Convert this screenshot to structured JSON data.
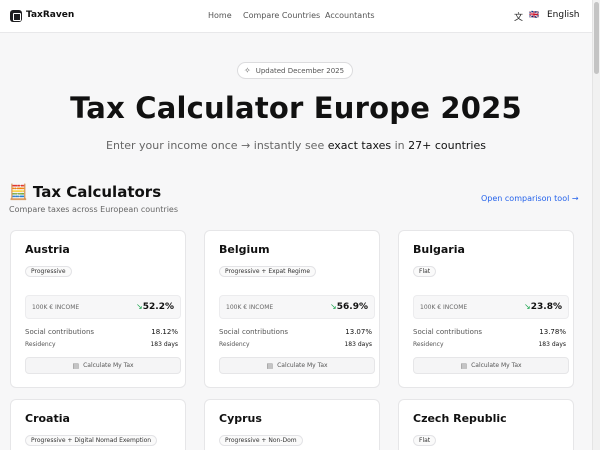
{
  "header": {
    "brand": "TaxRaven",
    "nav": [
      {
        "label": "Home"
      },
      {
        "label": "Compare Countries"
      },
      {
        "label": "Accountants"
      }
    ],
    "lang_icon": "translate-icon",
    "lang_flag": "🇬🇧",
    "lang_label": "English"
  },
  "hero": {
    "badge": "Updated December 2025",
    "badge_icon": "sparkle-icon",
    "title": "Tax Calculator Europe 2025",
    "sub_1": "Enter your income once → instantly see ",
    "sub_2": "exact taxes",
    "sub_3": " in ",
    "sub_4": "27+ countries"
  },
  "section": {
    "title": "🧮 Tax Calculators",
    "subtitle": "Compare taxes across European countries",
    "link": "Open comparison tool →"
  },
  "cards": [
    {
      "name": "Austria",
      "tag": "Progressive",
      "income_label": "100K € INCOME",
      "rate": "52.2%",
      "social_label": "Social contributions",
      "social": "18.12%",
      "residency_label": "Residency",
      "residency": "183 days",
      "button": "Calculate My Tax"
    },
    {
      "name": "Belgium",
      "tag": "Progressive + Expat Regime",
      "income_label": "100K € INCOME",
      "rate": "56.9%",
      "social_label": "Social contributions",
      "social": "13.07%",
      "residency_label": "Residency",
      "residency": "183 days",
      "button": "Calculate My Tax"
    },
    {
      "name": "Bulgaria",
      "tag": "Flat",
      "income_label": "100K € INCOME",
      "rate": "23.8%",
      "social_label": "Social contributions",
      "social": "13.78%",
      "residency_label": "Residency",
      "residency": "183 days",
      "button": "Calculate My Tax"
    },
    {
      "name": "Croatia",
      "tag": "Progressive + Digital Nomad Exemption"
    },
    {
      "name": "Cyprus",
      "tag": "Progressive + Non-Dom"
    },
    {
      "name": "Czech Republic",
      "tag": "Flat"
    }
  ]
}
